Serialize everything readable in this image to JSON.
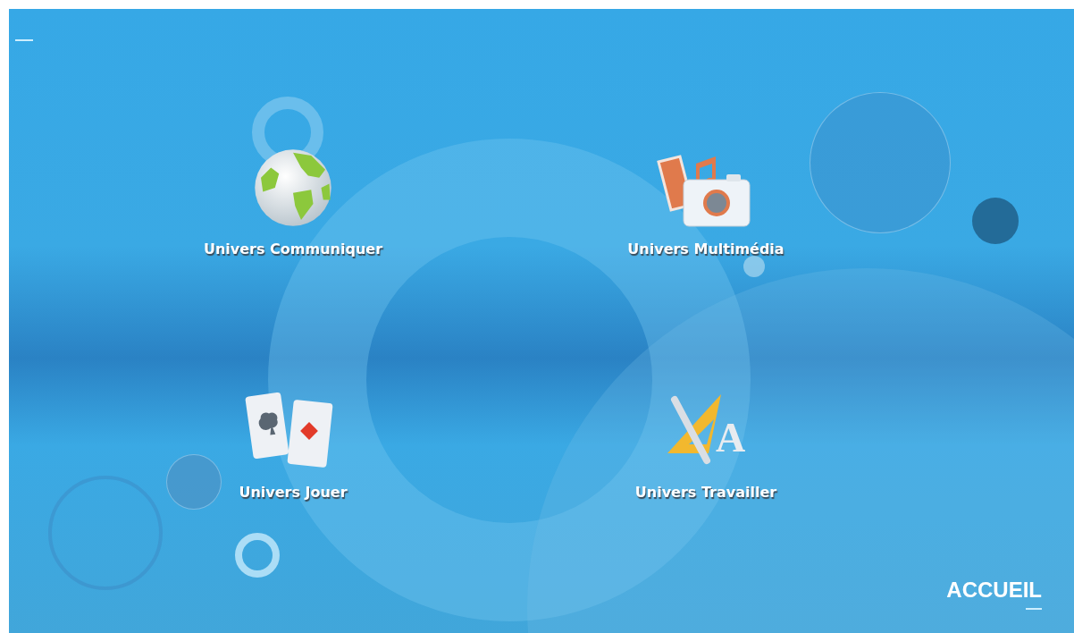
{
  "rows": [
    {
      "tiles": [
        {
          "label": "Univers Communiquer",
          "kind": "globe"
        },
        {
          "label": "Univers Multimédia",
          "kind": "media"
        }
      ]
    },
    {
      "tiles": [
        {
          "label": "Univers Jouer",
          "kind": "cards"
        },
        {
          "label": "Univers Travailler",
          "kind": "work",
          "icon_letter": "A"
        }
      ]
    }
  ],
  "footer": {
    "label": "ACCUEIL"
  }
}
